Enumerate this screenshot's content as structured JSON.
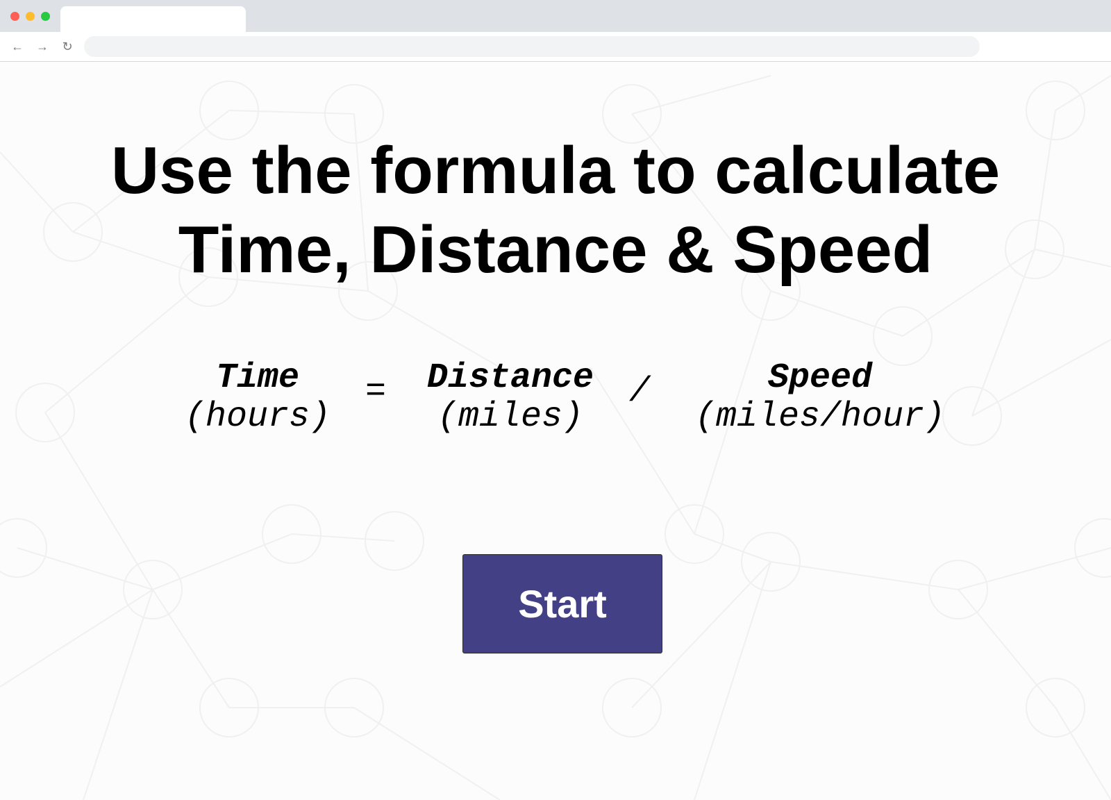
{
  "browser": {
    "address_value": "",
    "back_glyph": "←",
    "forward_glyph": "→",
    "reload_glyph": "↻"
  },
  "main": {
    "headline_line1": "Use the formula to calculate",
    "headline_line2": "Time, Distance & Speed",
    "formula": {
      "time_term": "Time",
      "time_unit": "(hours)",
      "equals": "=",
      "distance_term": "Distance",
      "distance_unit": "(miles)",
      "divide": "/",
      "speed_term": "Speed",
      "speed_unit": "(miles/hour)"
    },
    "start_label": "Start"
  },
  "colors": {
    "button_background": "#434086",
    "button_text": "#ffffff",
    "page_background": "#fcfcfc",
    "pattern_stroke": "#efefef"
  }
}
